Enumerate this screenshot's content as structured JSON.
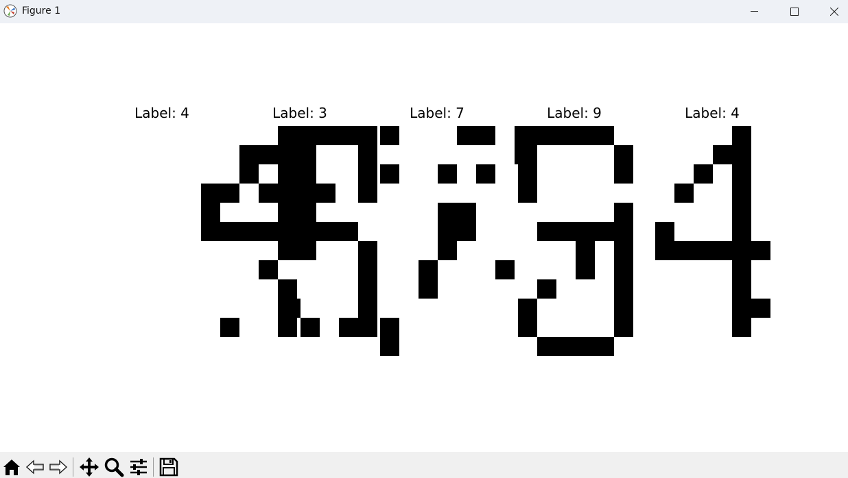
{
  "window": {
    "title": "Figure 1"
  },
  "figure": {
    "panels": [
      {
        "title": "Label: 4",
        "grid": [
          "0000000001100",
          "0000000111100",
          "0000000101100",
          "0000011011110",
          "0000010001100",
          "0000011111110",
          "0000000001100",
          "0000000010000",
          "0000000001000",
          "0000000001000",
          "0000001001000"
        ]
      },
      {
        "title": "Label: 3",
        "grid": [
          "0001111000000",
          "0010001000000",
          "0000001000000",
          "0001001000000",
          "0000000000000",
          "0000110000000",
          "0000001000000",
          "0000001000000",
          "0000001000000",
          "0010001000000",
          "0001011000000"
        ]
      },
      {
        "title": "Label: 7",
        "grid": [
          "1000110100000",
          "0000000100000",
          "1001010000000",
          "0000000000000",
          "0001100000000",
          "0001100000000",
          "0001000000000",
          "0010001000000",
          "0010000000000",
          "0000000000000",
          "1000000000000",
          "1000000000000"
        ]
      },
      {
        "title": "Label: 9",
        "grid": [
          "1111100000000",
          "1000010000000",
          "1000010000000",
          "1000000000000",
          "0000010000000",
          "0111110000000",
          "0001010000000",
          "0001010000000",
          "0100010000000",
          "1000010000000",
          "1000010000000",
          "0111100000000"
        ]
      },
      {
        "title": "Label: 4",
        "grid": [
          "0000100000000",
          "0001100000000",
          "0010100000000",
          "0100100000000",
          "0000100000000",
          "1000100000000",
          "1111110000000",
          "0000100000000",
          "0000100000000",
          "0000110000000",
          "0000100000000"
        ]
      }
    ]
  },
  "toolbar": {
    "buttons": [
      "home-icon",
      "back-arrow-icon",
      "forward-arrow-icon",
      "pan-icon",
      "zoom-icon",
      "configure-subplots-icon",
      "save-icon"
    ]
  }
}
